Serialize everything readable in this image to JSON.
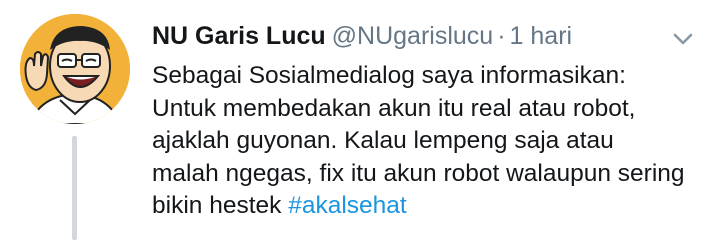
{
  "tweet": {
    "author_name": "NU Garis Lucu",
    "handle": "@NUgarislucu",
    "separator": "·",
    "time": "1 hari",
    "text_lines": [
      "Sebagai Sosialmedialog saya informasikan:",
      "Untuk membedakan akun itu real atau robot,",
      "ajaklah guyonan. Kalau lempeng saja atau",
      "malah ngegas, fix itu akun robot walaupun sering",
      "bikin hestek "
    ],
    "hashtag": "#akalsehat"
  },
  "icons": {
    "avatar": "cartoon-portrait-avatar",
    "menu": "chevron-down-icon"
  },
  "colors": {
    "text": "#14171a",
    "muted": "#657786",
    "link": "#1b95e0",
    "avatar_bg": "#f2b23a"
  }
}
